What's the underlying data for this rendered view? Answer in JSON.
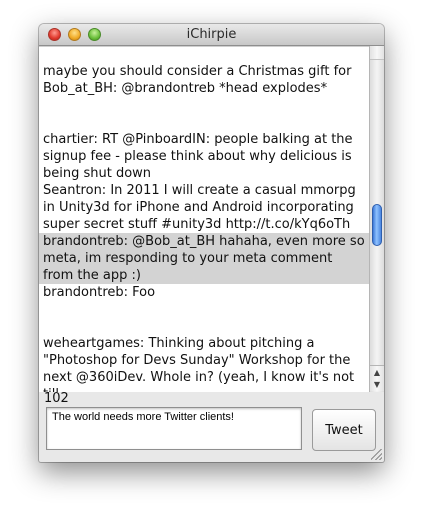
{
  "window": {
    "title": "iChirpie"
  },
  "feed": {
    "items": [
      {
        "text": "maybe you should consider a Christmas gift for Bob_at_BH: @brandontreb *head explodes*"
      },
      {
        "text": "chartier: RT @PinboardIN: people balking at the signup fee - please think about why delicious is being shut down"
      },
      {
        "text": "Seantron: In 2011 I will create a casual mmorpg in Unity3d for iPhone and Android incorporating super secret stuff #unity3d http://t.co/kYq6oTh"
      },
      {
        "text": "brandontreb: @Bob_at_BH hahaha, even more so meta, im responding to your meta comment from the app :)",
        "selected": true
      },
      {
        "text": "brandontreb: Foo"
      },
      {
        "text": "weheartgames: Thinking about pitching a \"Photoshop for Devs Sunday\" Workshop for the next @360iDev. Whole in? (yeah, I know it's not till"
      }
    ]
  },
  "composer": {
    "char_count": "102",
    "text": "The world needs more Twitter clients!",
    "button_label": "Tweet"
  },
  "colors": {
    "selection": "#d3d3d3",
    "scroll_thumb": "#5a94e8"
  }
}
